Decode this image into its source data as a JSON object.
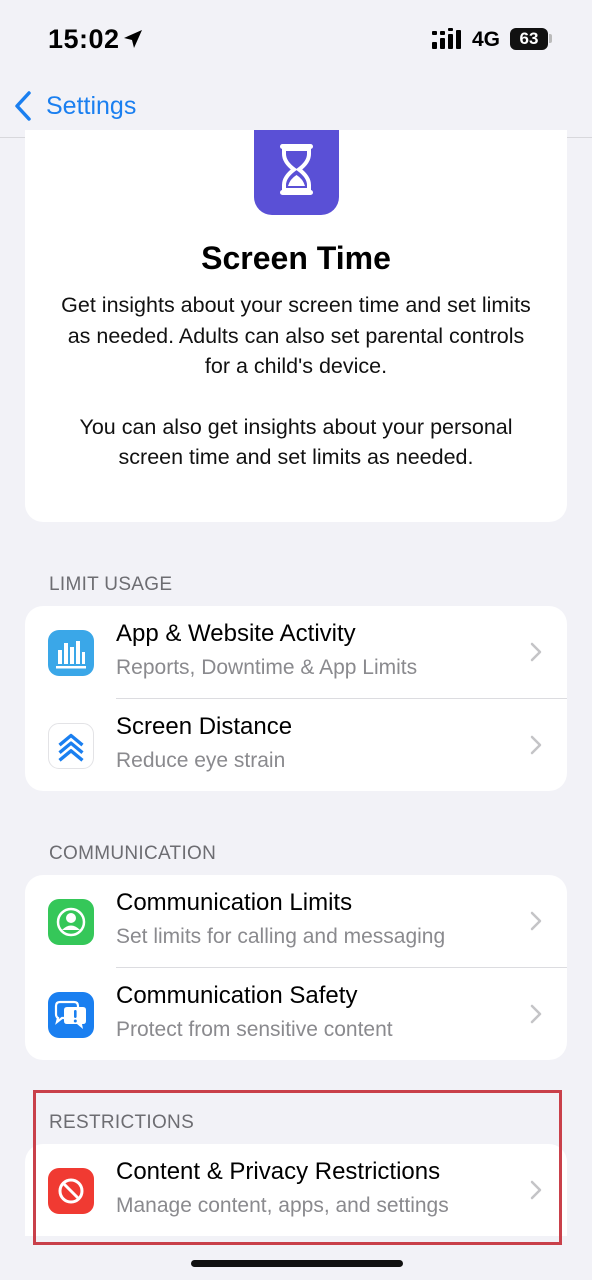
{
  "status_bar": {
    "time": "15:02",
    "network": "4G",
    "battery": "63"
  },
  "nav": {
    "back_label": "Settings"
  },
  "hero": {
    "title": "Screen Time",
    "desc_1": "Get insights about your screen time and set limits as needed. Adults can also set parental controls for a child's device.",
    "desc_2": "You can also get insights about your personal screen time and set limits as needed."
  },
  "sections": {
    "limit_usage": {
      "header": "LIMIT USAGE",
      "items": [
        {
          "title": "App & Website Activity",
          "subtitle": "Reports, Downtime & App Limits",
          "icon": "bar-chart-icon",
          "color": "#3aa7e8"
        },
        {
          "title": "Screen Distance",
          "subtitle": "Reduce eye strain",
          "icon": "chevrons-up-icon",
          "color": "#1a7ff0"
        }
      ]
    },
    "communication": {
      "header": "COMMUNICATION",
      "items": [
        {
          "title": "Communication Limits",
          "subtitle": "Set limits for calling and messaging",
          "icon": "person-circle-icon",
          "color": "#35c759"
        },
        {
          "title": "Communication Safety",
          "subtitle": "Protect from sensitive content",
          "icon": "message-alert-icon",
          "color": "#1a7ff0"
        }
      ]
    },
    "restrictions": {
      "header": "RESTRICTIONS",
      "items": [
        {
          "title": "Content & Privacy Restrictions",
          "subtitle": "Manage content, apps, and settings",
          "icon": "no-entry-icon",
          "color": "#f03a32"
        }
      ]
    }
  },
  "colors": {
    "accent": "#1a7ff0",
    "background": "#f2f2f7",
    "highlight": "#c9404a"
  }
}
